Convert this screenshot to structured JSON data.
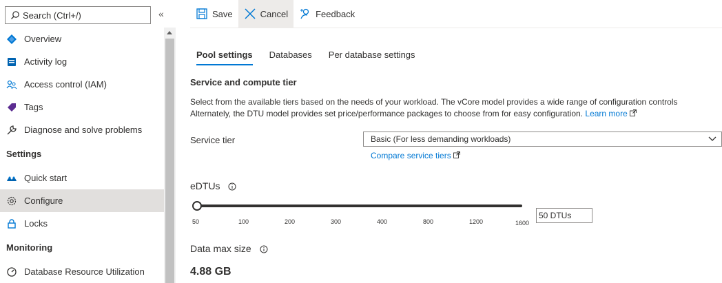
{
  "search": {
    "placeholder": "Search (Ctrl+/)"
  },
  "collapse_glyph": "«",
  "nav": {
    "overview": "Overview",
    "activity_log": "Activity log",
    "access_control": "Access control (IAM)",
    "tags": "Tags",
    "diagnose": "Diagnose and solve problems",
    "settings_section": "Settings",
    "quick_start": "Quick start",
    "configure": "Configure",
    "locks": "Locks",
    "monitoring_section": "Monitoring",
    "db_resource_util": "Database Resource Utilization"
  },
  "toolbar": {
    "save": "Save",
    "cancel": "Cancel",
    "feedback": "Feedback"
  },
  "tabs": {
    "pool_settings": "Pool settings",
    "databases": "Databases",
    "per_db": "Per database settings"
  },
  "section": {
    "title": "Service and compute tier",
    "desc_line1": "Select from the available tiers based on the needs of your workload. The vCore model provides a wide range of configuration controls",
    "desc_line2": "Alternately, the DTU model provides set price/performance packages to choose from for easy configuration.",
    "learn_more": "Learn more"
  },
  "service_tier": {
    "label": "Service tier",
    "value": "Basic (For less demanding workloads)",
    "compare_link": "Compare service tiers"
  },
  "edtus": {
    "label": "eDTUs",
    "ticks": [
      "50",
      "100",
      "200",
      "300",
      "400",
      "800",
      "1200",
      "1600"
    ],
    "value": "50 DTUs",
    "slider_fraction": 0
  },
  "max_size": {
    "label": "Data max size",
    "value": "4.88 GB"
  },
  "colors": {
    "accent": "#0078d4",
    "active_nav": "#e1dfdd"
  }
}
